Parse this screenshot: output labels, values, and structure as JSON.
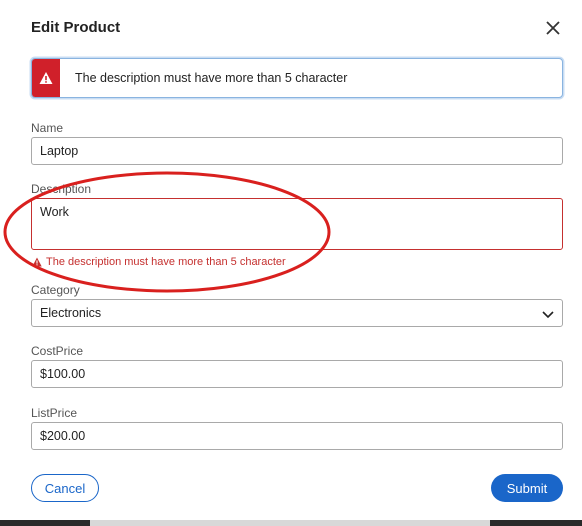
{
  "dialog": {
    "title": "Edit Product",
    "close_icon": "close-icon"
  },
  "alert": {
    "icon": "warning-icon",
    "message": "The description must have more than 5 character",
    "accent_color": "#d0202a"
  },
  "form": {
    "name": {
      "label": "Name",
      "value": "Laptop"
    },
    "description": {
      "label": "Description",
      "value": "Work",
      "error": "The description must have more than 5 character",
      "error_color": "#c5302f"
    },
    "category": {
      "label": "Category",
      "value": "Electronics"
    },
    "cost_price": {
      "label": "CostPrice",
      "value": "$100.00"
    },
    "list_price": {
      "label": "ListPrice",
      "value": "$200.00"
    }
  },
  "actions": {
    "cancel_label": "Cancel",
    "submit_label": "Submit",
    "primary_color": "#1a66c9"
  },
  "annotation": {
    "shape": "ellipse",
    "color": "#d9201e"
  }
}
